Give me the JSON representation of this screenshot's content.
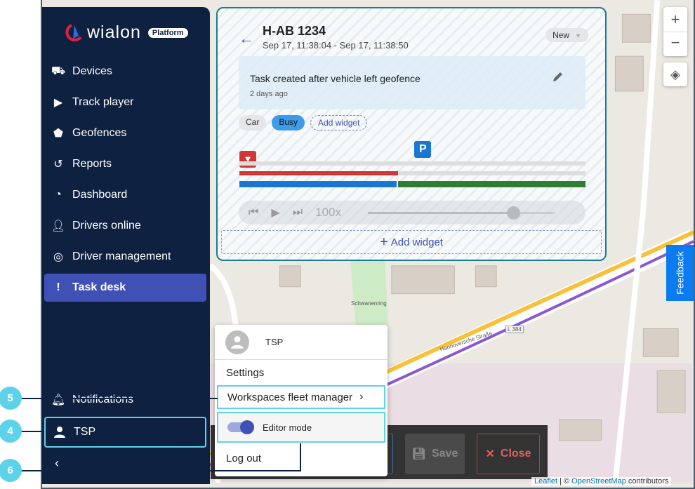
{
  "brand": {
    "name": "wialon",
    "badge": "Platform"
  },
  "sidebar": {
    "items": [
      {
        "label": "Devices",
        "icon": "devices-icon"
      },
      {
        "label": "Track player",
        "icon": "play-circle-icon"
      },
      {
        "label": "Geofences",
        "icon": "pentagon-icon"
      },
      {
        "label": "Reports",
        "icon": "history-icon"
      },
      {
        "label": "Dashboard",
        "icon": "pie-chart-icon"
      },
      {
        "label": "Drivers online",
        "icon": "driver-online-icon"
      },
      {
        "label": "Driver management",
        "icon": "steering-wheel-icon"
      },
      {
        "label": "Task desk",
        "icon": "clipboard-alert-icon",
        "active": true
      }
    ],
    "notifications": "Notifications",
    "user": "TSP"
  },
  "task": {
    "title": "H-AB 1234",
    "period": "Sep 17, 11:38:04 - Sep 17, 11:38:50",
    "status": "New",
    "note": "Task created after vehicle left geofence",
    "note_time": "2 days ago",
    "chips": [
      "Car",
      "Busy"
    ],
    "add_widget_chip": "Add widget",
    "timeline": {
      "red_fraction": 0.458,
      "blue_fraction": 0.458,
      "parking_position": 0.53
    },
    "player": {
      "speed": "100x",
      "progress": 0.78
    },
    "add_widget": "Add widget"
  },
  "menu": {
    "user": "TSP",
    "settings": "Settings",
    "workspaces": "Workspaces fleet manager",
    "editor_mode": "Editor mode",
    "editor_on": true,
    "logout": "Log out"
  },
  "bottombar": {
    "save": "Save",
    "close": "Close"
  },
  "map": {
    "feedback": "Feedback",
    "street1": "Hannoversche Straße",
    "street2": "Schwanenring",
    "road": "L 384",
    "attr_leaflet": "Leaflet",
    "attr_sep": " | © ",
    "attr_osm": "OpenStreetMap",
    "attr_rest": " contributors"
  },
  "callouts": [
    "5",
    "4",
    "6"
  ],
  "colors": {
    "sidebar": "#0f2140",
    "accent": "#3f51b5",
    "highlight": "#5dd3ea"
  }
}
